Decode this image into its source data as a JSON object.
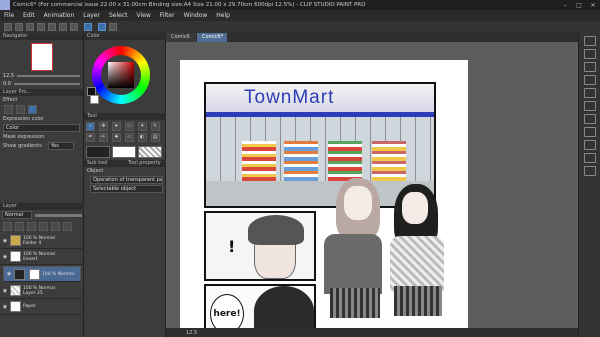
{
  "title": "Comic6* (For commercial issue 22.00 x 31.00cm Binding size:A4 Size 21.00 x 29.70cm 600dpi 12.5%) - CLIP STUDIO PAINT PRO",
  "menu": [
    "File",
    "Edit",
    "Animation",
    "Layer",
    "Select",
    "View",
    "Filter",
    "Window",
    "Help"
  ],
  "tabs": [
    "Comic6",
    "Comic6*"
  ],
  "left": {
    "navigator_title": "Navigator",
    "zoom": "12.5",
    "rotate": "0.0",
    "layer_prop_title": "Layer Pro...",
    "effect_label": "Effect",
    "expression_color_label": "Expression color",
    "expression_color_value": "Color",
    "mask_expression_label": "Mask expression",
    "show_gradients_label": "Show gradients",
    "show_gradients_value": "Yes",
    "layer_title": "Layer",
    "blend_mode": "Normal",
    "layers": [
      {
        "name": "100 % Normal",
        "sub": "Folder 4",
        "selected": false
      },
      {
        "name": "100 % Normal",
        "sub": "lineart",
        "selected": false
      },
      {
        "name": "100 % Normal",
        "sub": "",
        "selected": true
      },
      {
        "name": "100 % Normal",
        "sub": "Layer 25",
        "selected": false
      },
      {
        "name": "",
        "sub": "Paper",
        "selected": false
      }
    ]
  },
  "mid": {
    "color_title": "Color",
    "tool_title": "Tool",
    "sub_tool_title": "Sub tool",
    "tool_property_title": "Tool property",
    "object_label": "Object",
    "op_label": "Operation of transparent par...",
    "selectable_label": "Selectable object"
  },
  "canvas": {
    "sign": "TownMart",
    "speech_here": "here!",
    "bottom_zoom": "12.5"
  },
  "colors": {
    "accent": "#4f6e95",
    "sign_text": "#2d3fb6"
  }
}
